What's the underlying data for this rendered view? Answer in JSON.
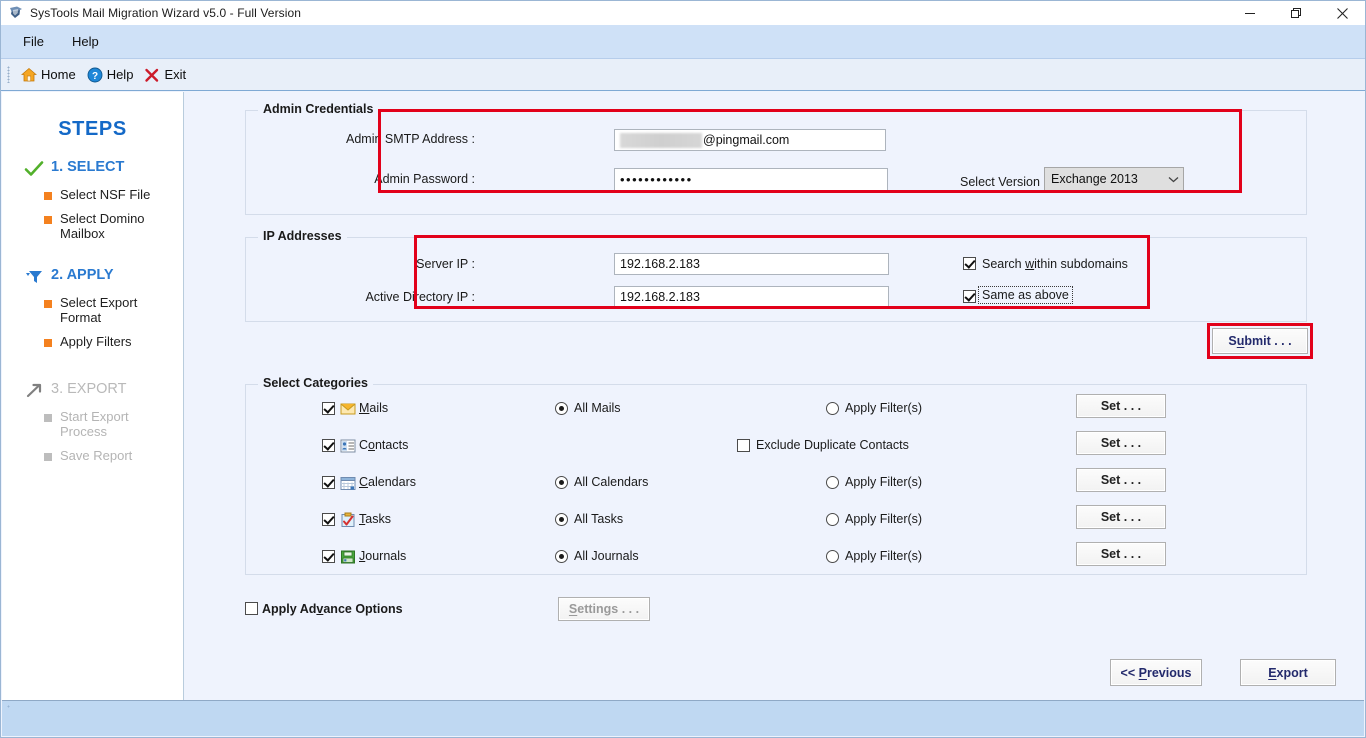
{
  "window": {
    "title": "SysTools Mail Migration Wizard v5.0 - Full Version",
    "app_icon": "shield-icon",
    "minimize": "minimize-icon",
    "restore": "restore-icon",
    "close": "close-icon"
  },
  "menubar": {
    "items": [
      {
        "label": "File"
      },
      {
        "label": "Help"
      }
    ]
  },
  "toolbar": {
    "items": [
      {
        "label": "Home",
        "icon": "home-icon"
      },
      {
        "label": "Help",
        "icon": "help-circle-icon"
      },
      {
        "label": "Exit",
        "icon": "close-x-icon"
      }
    ]
  },
  "sidebar": {
    "title": "STEPS",
    "groups": [
      {
        "icon": "check-icon",
        "label": "1. SELECT",
        "state": "done",
        "substeps": [
          {
            "label": "Select NSF File",
            "state": "active"
          },
          {
            "label": "Select Domino Mailbox",
            "state": "active"
          }
        ]
      },
      {
        "icon": "filter-icon",
        "label": "2. APPLY",
        "state": "current",
        "substeps": [
          {
            "label": "Select Export Format",
            "state": "active"
          },
          {
            "label": "Apply Filters",
            "state": "active"
          }
        ]
      },
      {
        "icon": "arrow-export-icon",
        "label": "3. EXPORT",
        "state": "disabled",
        "substeps": [
          {
            "label": "Start Export Process",
            "state": "disabled"
          },
          {
            "label": "Save Report",
            "state": "disabled"
          }
        ]
      }
    ]
  },
  "admin_credentials": {
    "legend": "Admin Credentials",
    "smtp_label": "Admin SMTP Address :",
    "smtp_value": "@pingmail.com",
    "smtp_redacted": true,
    "password_label": "Admin Password :",
    "password_value": "••••••••••••",
    "version_label": "Select Version",
    "version_value": "Exchange 2013",
    "version_options": [
      "Exchange 2013"
    ]
  },
  "ip_addresses": {
    "legend": "IP Addresses",
    "server_ip_label": "Server IP :",
    "server_ip_value": "192.168.2.183",
    "ad_ip_label": "Active Directory IP :",
    "ad_ip_value": "192.168.2.183",
    "search_subdomains_label": "Search within subdomains",
    "search_subdomains_checked": true,
    "same_as_above_label": "Same as above",
    "same_as_above_checked": true
  },
  "submit_button": {
    "label": "Submit . . ."
  },
  "select_categories": {
    "legend": "Select Categories",
    "set_button_label": "Set . . .",
    "rows": [
      {
        "name": "Mails",
        "icon": "mail-icon",
        "checked": true,
        "option_label": "All Mails",
        "option_type": "radio",
        "option_checked": true,
        "filter_label": "Apply Filter(s)",
        "filter_checked": false,
        "has_set": true
      },
      {
        "name": "Contacts",
        "icon": "contacts-icon",
        "checked": true,
        "option_label": "Exclude Duplicate Contacts",
        "option_type": "checkbox",
        "option_checked": false,
        "filter_label": "",
        "filter_checked": false,
        "has_set": true
      },
      {
        "name": "Calendars",
        "icon": "calendar-icon",
        "checked": true,
        "option_label": "All Calendars",
        "option_type": "radio",
        "option_checked": true,
        "filter_label": "Apply Filter(s)",
        "filter_checked": false,
        "has_set": true
      },
      {
        "name": "Tasks",
        "icon": "tasks-icon",
        "checked": true,
        "option_label": "All Tasks",
        "option_type": "radio",
        "option_checked": true,
        "filter_label": "Apply Filter(s)",
        "filter_checked": false,
        "has_set": true
      },
      {
        "name": "Journals",
        "icon": "journals-icon",
        "checked": true,
        "option_label": "All Journals",
        "option_type": "radio",
        "option_checked": true,
        "filter_label": "Apply Filter(s)",
        "filter_checked": false,
        "has_set": true
      }
    ]
  },
  "advance_options": {
    "label": "Apply Advance Options",
    "checked": false,
    "settings_button": "Settings . . .",
    "settings_enabled": false
  },
  "footer": {
    "previous_button": "<< Previous",
    "export_button": "Export"
  },
  "colors": {
    "accent_blue": "#2a7ad0",
    "bullet_orange": "#f4811f",
    "highlight_red": "#e2001a",
    "background": "#eff3fd",
    "statusbar": "#bfd8f2"
  }
}
